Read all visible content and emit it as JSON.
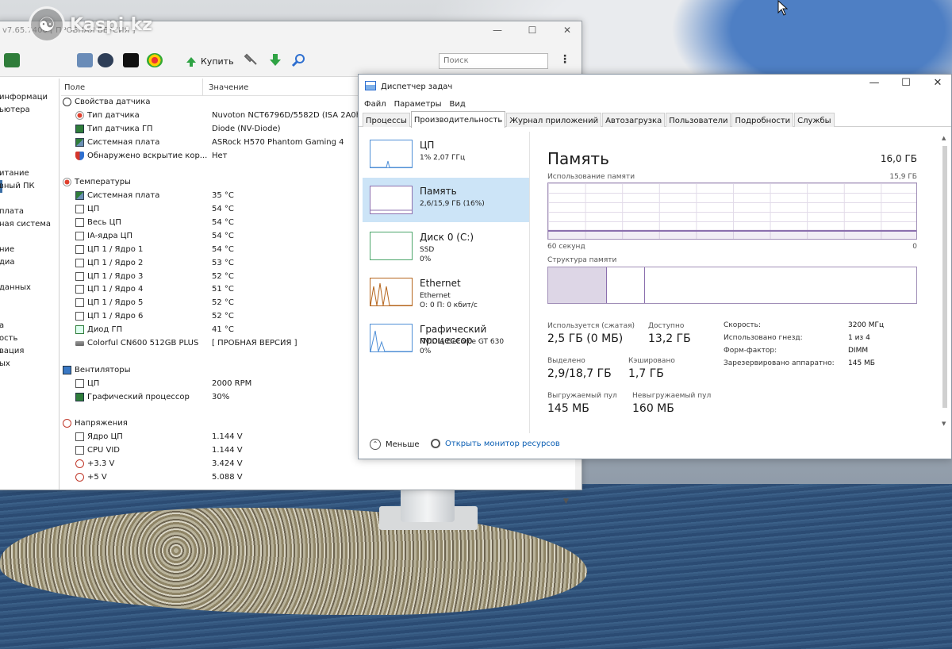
{
  "aida": {
    "title": "v7.65.7400  [ ПРОБНАЯ ВЕРСИЯ ]",
    "toolbar": {
      "buy_label": "Купить",
      "search_placeholder": "Поиск"
    },
    "watermark": "Kaspi.kz",
    "left_items": [
      "",
      "информаци",
      "ьютера",
      "",
      "",
      "",
      "",
      "итание",
      "вный ПК",
      "",
      "плата",
      "ная система",
      "",
      "ние",
      "диа",
      "",
      "данных",
      "",
      "",
      "а",
      "ость",
      "вация",
      "ых"
    ],
    "columns": {
      "field": "Поле",
      "value": "Значение"
    },
    "rows": [
      {
        "kind": "group",
        "icon": "info",
        "label": "Свойства датчика",
        "value": ""
      },
      {
        "kind": "item",
        "icon": "therm",
        "label": "Тип датчика",
        "value": "Nuvoton NCT6796D/5582D  (ISA 2A0h)"
      },
      {
        "kind": "item",
        "icon": "gpu",
        "label": "Тип датчика ГП",
        "value": "Diode  (NV-Diode)"
      },
      {
        "kind": "item",
        "icon": "mb",
        "label": "Системная плата",
        "value": "ASRock H570 Phantom Gaming 4"
      },
      {
        "kind": "item",
        "icon": "shield",
        "label": "Обнаружено вскрытие кор...",
        "value": "Нет"
      },
      {
        "kind": "spacer",
        "label": "",
        "value": ""
      },
      {
        "kind": "group",
        "icon": "therm",
        "label": "Температуры",
        "value": ""
      },
      {
        "kind": "item",
        "icon": "mb",
        "label": "Системная плата",
        "value": "35 °C"
      },
      {
        "kind": "item",
        "icon": "sq",
        "label": "ЦП",
        "value": "54 °C"
      },
      {
        "kind": "item",
        "icon": "sq",
        "label": "Весь ЦП",
        "value": "54 °C"
      },
      {
        "kind": "item",
        "icon": "sq",
        "label": "IA-ядра ЦП",
        "value": "54 °C"
      },
      {
        "kind": "item",
        "icon": "sq",
        "label": "ЦП 1 / Ядро 1",
        "value": "54 °C"
      },
      {
        "kind": "item",
        "icon": "sq",
        "label": "ЦП 1 / Ядро 2",
        "value": "53 °C"
      },
      {
        "kind": "item",
        "icon": "sq",
        "label": "ЦП 1 / Ядро 3",
        "value": "52 °C"
      },
      {
        "kind": "item",
        "icon": "sq",
        "label": "ЦП 1 / Ядро 4",
        "value": "51 °C"
      },
      {
        "kind": "item",
        "icon": "sq",
        "label": "ЦП 1 / Ядро 5",
        "value": "52 °C"
      },
      {
        "kind": "item",
        "icon": "sq",
        "label": "ЦП 1 / Ядро 6",
        "value": "52 °C"
      },
      {
        "kind": "item",
        "icon": "diode",
        "label": "Диод ГП",
        "value": "41 °C"
      },
      {
        "kind": "item",
        "icon": "disk",
        "label": "Colorful CN600 512GB PLUS",
        "value": "[ ПРОБНАЯ ВЕРСИЯ ]"
      },
      {
        "kind": "spacer",
        "label": "",
        "value": ""
      },
      {
        "kind": "group",
        "icon": "fan",
        "label": "Вентиляторы",
        "value": ""
      },
      {
        "kind": "item",
        "icon": "sq",
        "label": "ЦП",
        "value": "2000 RPM"
      },
      {
        "kind": "item",
        "icon": "gpu",
        "label": "Графический процессор",
        "value": "30%"
      },
      {
        "kind": "spacer",
        "label": "",
        "value": ""
      },
      {
        "kind": "group",
        "icon": "volt",
        "label": "Напряжения",
        "value": ""
      },
      {
        "kind": "item",
        "icon": "sq",
        "label": "Ядро ЦП",
        "value": "1.144 V"
      },
      {
        "kind": "item",
        "icon": "sq",
        "label": "CPU VID",
        "value": "1.144 V"
      },
      {
        "kind": "item",
        "icon": "volt",
        "label": "+3.3 V",
        "value": "3.424 V"
      },
      {
        "kind": "item",
        "icon": "volt",
        "label": "+5 V",
        "value": "5.088 V"
      }
    ]
  },
  "taskmgr": {
    "title": "Диспетчер задач",
    "menu": [
      "Файл",
      "Параметры",
      "Вид"
    ],
    "tabs": [
      "Процессы",
      "Производительность",
      "Журнал приложений",
      "Автозагрузка",
      "Пользователи",
      "Подробности",
      "Службы"
    ],
    "active_tab": 1,
    "perf_items": [
      {
        "name": "ЦП",
        "sub1": "1% 2,07 ГГц",
        "sub2": "",
        "color": "#4f8fd6"
      },
      {
        "name": "Память",
        "sub1": "2,6/15,9 ГБ (16%)",
        "sub2": "",
        "color": "#8b6fae"
      },
      {
        "name": "Диск 0 (C:)",
        "sub1": "SSD",
        "sub2": "0%",
        "color": "#4da66b"
      },
      {
        "name": "Ethernet",
        "sub1": "Ethernet",
        "sub2": "О: 0 П: 0 кбит/с",
        "color": "#b5651d"
      },
      {
        "name": "Графический процессор",
        "sub1": "NVIDIA GeForce GT 630",
        "sub2": "0%",
        "color": "#4f8fd6"
      }
    ],
    "memory": {
      "title": "Память",
      "total": "16,0 ГБ",
      "usage_label": "Использование памяти",
      "usage_max": "15,9 ГБ",
      "axis_left": "60 секунд",
      "axis_right": "0",
      "usage_fraction": 0.16,
      "structure_label": "Структура памяти",
      "stats": [
        {
          "label": "Используется (сжатая)",
          "value": "2,5 ГБ (0 МБ)"
        },
        {
          "label": "Доступно",
          "value": "13,2 ГБ"
        },
        {
          "label": "Выделено",
          "value": "2,9/18,7 ГБ"
        },
        {
          "label": "Кэшировано",
          "value": "1,7 ГБ"
        },
        {
          "label": "Выгружаемый пул",
          "value": "145 МБ"
        },
        {
          "label": "Невыгружаемый пул",
          "value": "160 МБ"
        }
      ],
      "specs": [
        {
          "label": "Скорость:",
          "value": "3200 МГц"
        },
        {
          "label": "Использовано гнезд:",
          "value": "1 из 4"
        },
        {
          "label": "Форм-фактор:",
          "value": "DIMM"
        },
        {
          "label": "Зарезервировано аппаратно:",
          "value": "145 МБ"
        }
      ]
    },
    "footer": {
      "less_label": "Меньше",
      "monitor_label": "Открыть монитор ресурсов"
    }
  }
}
